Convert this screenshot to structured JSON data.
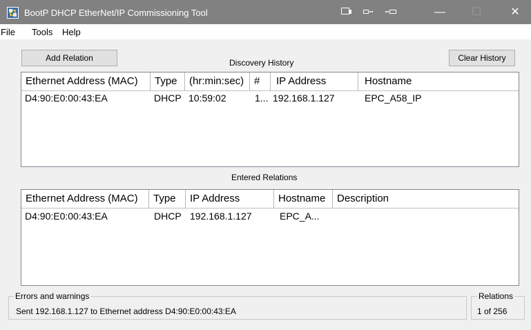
{
  "window": {
    "title": "BootP DHCP EtherNet/IP Commissioning Tool",
    "minimize_glyph": "—",
    "maximize_glyph": "☐",
    "close_glyph": "✕"
  },
  "menu": [
    "File",
    "Tools",
    "Help"
  ],
  "buttons": {
    "add_relation": "Add Relation",
    "clear_history": "Clear History"
  },
  "discovery": {
    "label": "Discovery History",
    "columns": [
      "Ethernet Address (MAC)",
      "Type",
      "(hr:min:sec)",
      "#",
      "IP Address",
      "Hostname"
    ],
    "rows": [
      {
        "mac": "D4:90:E0:00:43:EA",
        "type": "DHCP",
        "time": "10:59:02",
        "count": "1...",
        "ip": "192.168.1.127",
        "hostname": "EPC_A58_IP"
      }
    ]
  },
  "relations": {
    "label": "Entered Relations",
    "columns": [
      "Ethernet Address (MAC)",
      "Type",
      "IP Address",
      "Hostname",
      "Description"
    ],
    "rows": [
      {
        "mac": "D4:90:E0:00:43:EA",
        "type": "DHCP",
        "ip": "192.168.1.127",
        "hostname": "EPC_A...",
        "description": ""
      }
    ]
  },
  "status": {
    "errors_label": "Errors and warnings",
    "errors_text": "Sent 192.168.1.127 to Ethernet address D4:90:E0:00:43:EA",
    "relations_label": "Relations",
    "relations_text": "1 of 256"
  },
  "colors": {
    "titlebar": "#818181",
    "window_bg": "#f0f0f0",
    "list_bg": "#ffffff"
  }
}
